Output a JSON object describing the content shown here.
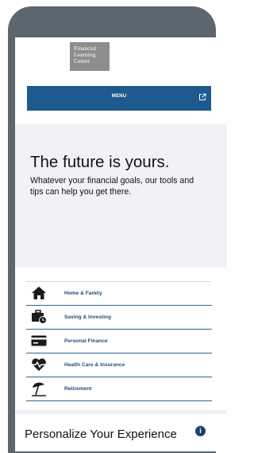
{
  "header": {
    "logo_lines": [
      "Financial",
      "Learning",
      "Center"
    ],
    "menu_label": "MENU",
    "menu_icon": "external-link-icon"
  },
  "hero": {
    "title": "The future is yours.",
    "subtitle": "Whatever your financial goals, our tools and tips can help you get there."
  },
  "categories": [
    {
      "label": "Home & Family",
      "icon": "house-icon"
    },
    {
      "label": "Saving & Investing",
      "icon": "briefcase-clock-icon"
    },
    {
      "label": "Personal Finance",
      "icon": "credit-card-icon"
    },
    {
      "label": "Health Care & Insurance",
      "icon": "heartbeat-icon"
    },
    {
      "label": "Retirement",
      "icon": "beach-umbrella-icon"
    }
  ],
  "personalize": {
    "title": "Personalize Your Experience",
    "info_icon": "info-icon",
    "info_glyph": "i"
  },
  "colors": {
    "frame": "#5c6770",
    "menu_bar": "#1e5a8e",
    "category_text": "#1e4f7d",
    "hero_bg": "#f1f2f7"
  }
}
